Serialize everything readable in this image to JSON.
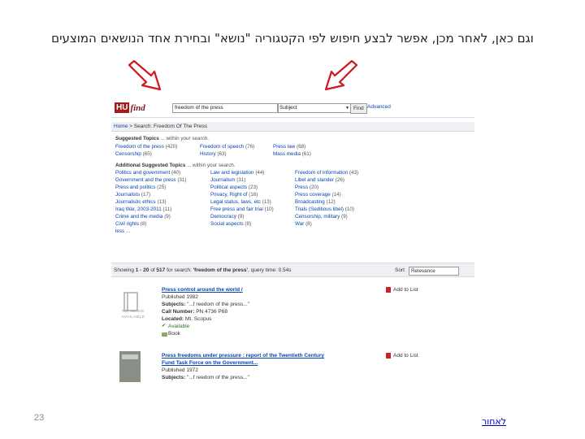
{
  "slide": {
    "headline": "וגם כאן, לאחר מכן, אפשר לבצע חיפוש לפי הקטגוריה \"נושא\" ובחירת אחד הנושאים המוצעים",
    "page_number": "23",
    "back_link": "לאחור"
  },
  "app": {
    "logo_hu": "HU",
    "logo_find": "find",
    "search_value": "freedom of the press",
    "search_type": "Subject",
    "find_label": "Find",
    "advanced_label": "Advanced"
  },
  "breadcrumb": {
    "home": "Home",
    "current": "Search: Freedom Of The Press"
  },
  "suggested": {
    "label": "Suggested Topics",
    "label_tail": " ... within your search.",
    "items": [
      {
        "text": "Freedom of the press",
        "count": "(420)"
      },
      {
        "text": "Freedom of speech",
        "count": "(76)"
      },
      {
        "text": "Press law",
        "count": "(68)"
      },
      {
        "text": "Censorship",
        "count": "(65)"
      },
      {
        "text": "History",
        "count": "(63)"
      },
      {
        "text": "Mass media",
        "count": "(61)"
      }
    ]
  },
  "additional": {
    "label": "Additional Suggested Topics",
    "label_tail": " ... within your search.",
    "col1": [
      {
        "text": "Politics and government",
        "count": "(40)"
      },
      {
        "text": "Government and the press",
        "count": "(31)"
      },
      {
        "text": "Press and politics",
        "count": "(25)"
      },
      {
        "text": "Journalists",
        "count": "(17)"
      },
      {
        "text": "Journalistic ethics",
        "count": "(13)"
      },
      {
        "text": "Iraq War, 2003-2011",
        "count": "(11)"
      },
      {
        "text": "Crime and the media",
        "count": "(9)"
      },
      {
        "text": "Civil rights",
        "count": "(8)"
      },
      {
        "text": "less ...",
        "count": ""
      }
    ],
    "col2": [
      {
        "text": "Law and legislation",
        "count": "(44)"
      },
      {
        "text": "Journalism",
        "count": "(31)"
      },
      {
        "text": "Political aspects",
        "count": "(23)"
      },
      {
        "text": "Privacy, Right of",
        "count": "(16)"
      },
      {
        "text": "Legal status, laws, etc",
        "count": "(13)"
      },
      {
        "text": "Free press and fair trial",
        "count": "(10)"
      },
      {
        "text": "Democracy",
        "count": "(9)"
      },
      {
        "text": "Social aspects",
        "count": "(8)"
      }
    ],
    "col3": [
      {
        "text": "Freedom of information",
        "count": "(43)"
      },
      {
        "text": "Libel and slander",
        "count": "(26)"
      },
      {
        "text": "Press",
        "count": "(20)"
      },
      {
        "text": "Press coverage",
        "count": "(14)"
      },
      {
        "text": "Broadcasting",
        "count": "(12)"
      },
      {
        "text": "Trials (Seditious libel)",
        "count": "(10)"
      },
      {
        "text": "Censorship, military",
        "count": "(9)"
      },
      {
        "text": "War",
        "count": "(8)"
      }
    ]
  },
  "results_bar": {
    "showing": "Showing",
    "range": "1 - 20",
    "of": "of",
    "total": "517",
    "for_search": "for search:",
    "query": "'freedom of the press'",
    "time": ", query time: 0.54s",
    "sort_label": "Sort",
    "sort_value": "Relevance"
  },
  "results": [
    {
      "title": "Press control around the world /",
      "published": "Published 1982",
      "subjects_label": "Subjects:",
      "subjects": "\"...f reedom of the press...\"",
      "call_label": "Call Number:",
      "call": "PN 4736 P68",
      "located_label": "Located:",
      "located": "Mt. Scopus",
      "availability": "Available",
      "format": "Book",
      "add": "Add to List",
      "noimage": "NO IMAGE AVAILABLE"
    },
    {
      "title_line1": "Press freedoms under pressure : report of the Twentieth Century",
      "title_line2": "Fund Task Force on the Government...",
      "published": "Published 1972",
      "subjects_label": "Subjects:",
      "subjects": "\"...f reedom of the press...\"",
      "add": "Add to List"
    }
  ],
  "colors": {
    "logo_red": "#a01c1c",
    "link_blue": "#0645ad",
    "arrow_red": "#d0181c"
  }
}
